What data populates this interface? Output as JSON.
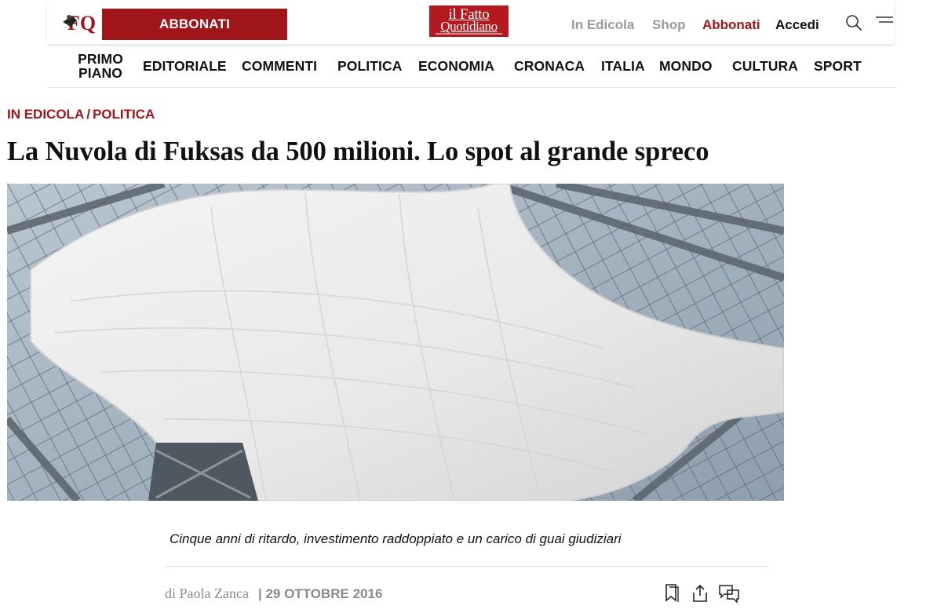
{
  "header": {
    "subscribe_button": "ABBONATI",
    "masthead_line1": "il Fatto",
    "masthead_line2": "Quotidiano",
    "links": {
      "in_edicola": "In Edicola",
      "shop": "Shop",
      "abbonati": "Abbonati",
      "accedi": "Accedi"
    },
    "icons": {
      "search": "search-icon",
      "menu": "menu-icon"
    }
  },
  "nav": {
    "primo_piano_1": "PRIMO",
    "primo_piano_2": "PIANO",
    "editoriale": "EDITORIALE",
    "commenti": "COMMENTI",
    "politica": "POLITICA",
    "economia": "ECONOMIA",
    "cronaca": "CRONACA",
    "italia": "ITALIA",
    "mondo": "MONDO",
    "cultura": "CULTURA",
    "sport": "SPORT"
  },
  "article": {
    "breadcrumb": {
      "section": "IN EDICOLA",
      "separator": "/",
      "category": "POLITICA"
    },
    "title": "La Nuvola di Fuksas da 500 milioni. Lo spot al grande spreco",
    "caption": "Cinque anni di ritardo, investimento raddoppiato e un carico di guai giudiziari",
    "author": "di Paola Zanca",
    "date": "| 29 OTTOBRE 2016",
    "actions": {
      "bookmark": "bookmark-icon",
      "share": "share-icon",
      "comments": "comments-icon"
    }
  },
  "colors": {
    "brand_red": "#a0151a",
    "masthead_red": "#b3191f",
    "muted_grey": "#9a9a9a"
  }
}
